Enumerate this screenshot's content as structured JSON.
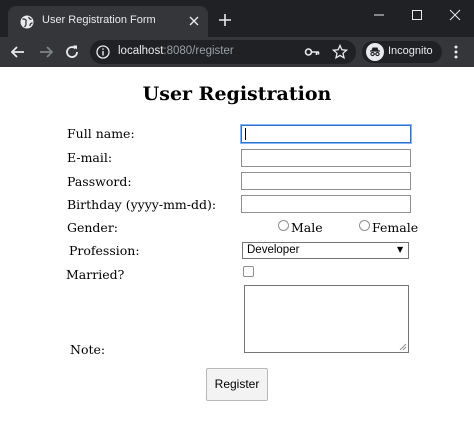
{
  "browser": {
    "tab": {
      "title": "User Registration Form"
    },
    "address_bar": {
      "host": "localhost",
      "path": ":8080/register"
    },
    "profile": {
      "label": "Incognito"
    }
  },
  "form": {
    "title": "User Registration",
    "fields": {
      "full_name": {
        "label": "Full name:",
        "value": ""
      },
      "email": {
        "label": "E-mail:",
        "value": ""
      },
      "password": {
        "label": "Password:",
        "value": ""
      },
      "birthday": {
        "label": "Birthday (yyyy-mm-dd):",
        "value": ""
      },
      "gender": {
        "label": "Gender:",
        "options": [
          "Male",
          "Female"
        ]
      },
      "profession": {
        "label": "Profession:",
        "selected": "Developer"
      },
      "married": {
        "label": "Married?",
        "checked": false
      },
      "note": {
        "label": "Note:",
        "value": ""
      }
    },
    "submit_label": "Register"
  },
  "colors": {
    "chrome_dark": "#202124",
    "chrome_toolbar": "#35363a",
    "focus_border": "#2b74c7",
    "page_background": "#ffffff"
  }
}
